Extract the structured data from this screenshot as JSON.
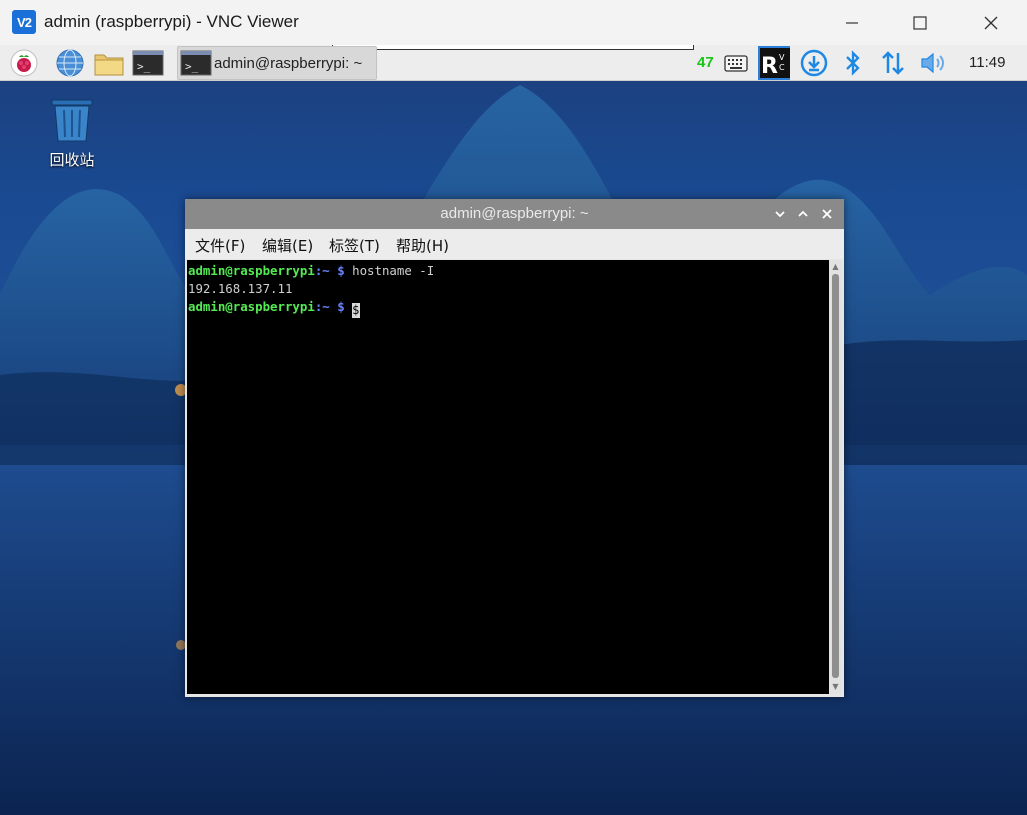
{
  "vnc_window": {
    "title": "admin (raspberrypi) - VNC Viewer",
    "logo_text": "V2"
  },
  "taskbar": {
    "task_label": "admin@raspberrypi: ~",
    "cpu_value": "47",
    "clock": "11:49",
    "launchers": [
      "raspberry-menu-icon",
      "web-browser-icon",
      "file-manager-icon",
      "terminal-icon"
    ],
    "tray": [
      "keyboard-icon",
      "vnc-server-icon",
      "download-icon",
      "bluetooth-icon",
      "network-icon",
      "volume-icon"
    ]
  },
  "desktop": {
    "trash_label": "回收站"
  },
  "terminal": {
    "title": "admin@raspberrypi: ~",
    "menu": [
      "文件(F)",
      "编辑(E)",
      "标签(T)",
      "帮助(H)"
    ],
    "lines": [
      {
        "user": "admin@raspberrypi",
        "path": ":~ $",
        "text": " hostname -I"
      },
      {
        "output": "192.168.137.11"
      },
      {
        "user": "admin@raspberrypi",
        "path": ":~ $",
        "text": " ",
        "cursor": "$"
      }
    ]
  },
  "colors": {
    "prompt_user": "#54ea54",
    "prompt_path": "#6a83ff",
    "vnc_brand": "#1a6fd8",
    "terminal_bg": "#000000"
  }
}
